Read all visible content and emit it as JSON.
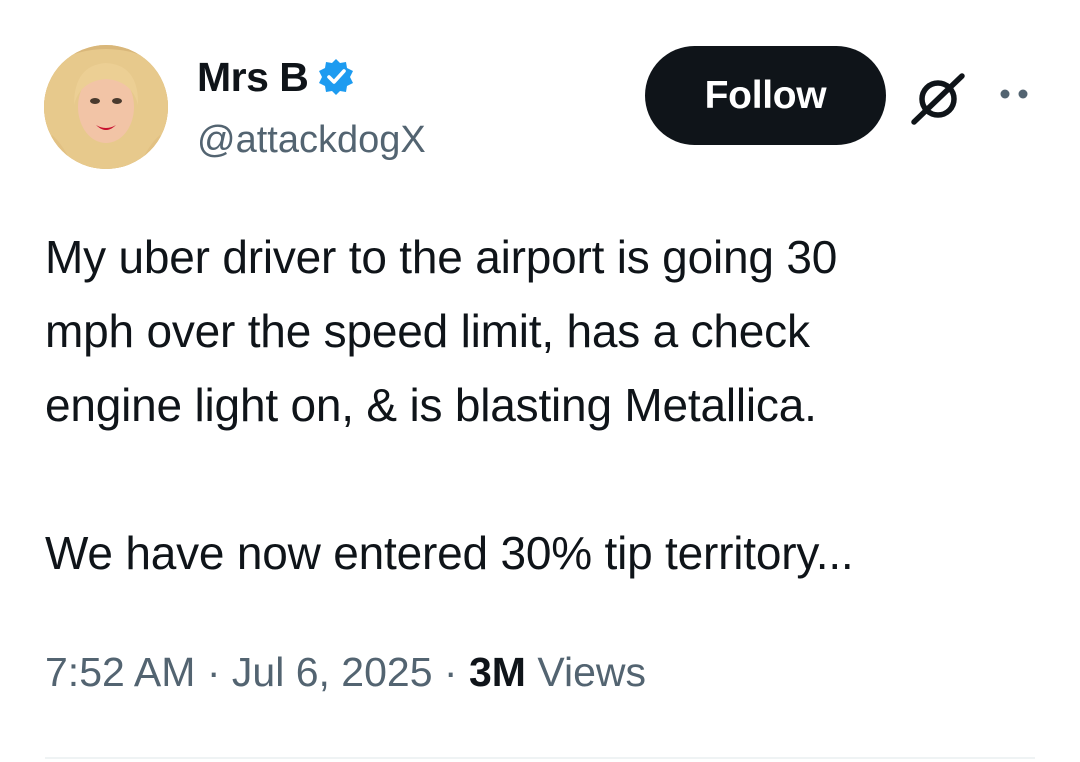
{
  "user": {
    "display_name": "Mrs B",
    "handle": "@attackdogX",
    "verified": true
  },
  "actions": {
    "follow_label": "Follow"
  },
  "icons": {
    "verified": "verified-badge-icon",
    "grok": "grok-icon",
    "more": "more-options-icon"
  },
  "tweet": {
    "paragraph1_lines": [
      "My uber driver to the airport is going 30",
      "mph over the speed limit, has a check",
      "engine light on, & is blasting Metallica."
    ],
    "paragraph2": "We have now entered 30% tip territory..."
  },
  "meta": {
    "time": "7:52 AM",
    "separator": "·",
    "date": "Jul 6, 2025",
    "views_count": "3M",
    "views_label": "Views"
  },
  "colors": {
    "text": "#0f1419",
    "secondary": "#536471",
    "verified_blue": "#1d9bf0",
    "button_bg": "#0f1419"
  }
}
